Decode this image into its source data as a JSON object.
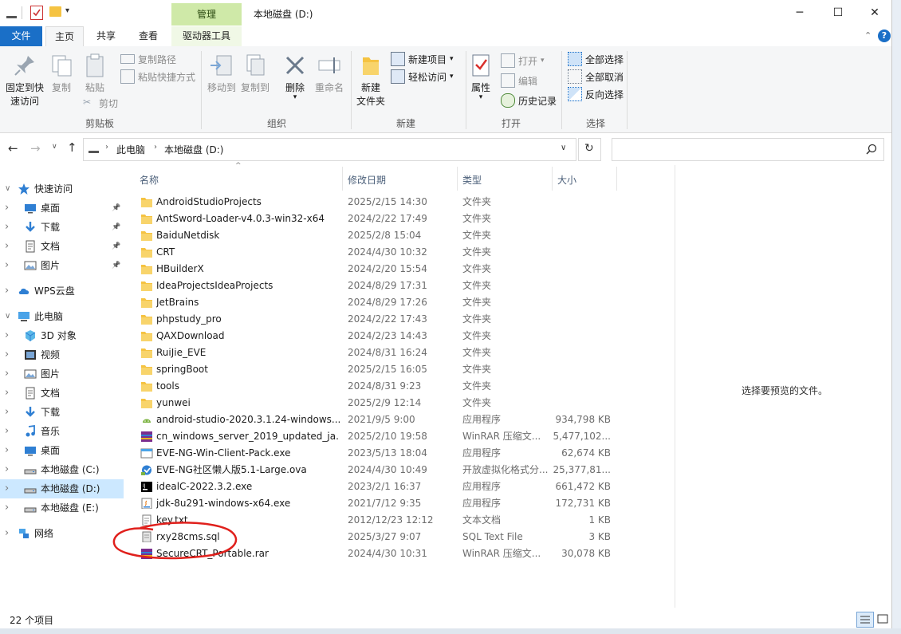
{
  "window": {
    "title": "本地磁盘 (D:)",
    "context_tab": "管理",
    "minimize": "─",
    "maximize": "☐",
    "close": "✕"
  },
  "ribbon_tabs": [
    {
      "label": "文件"
    },
    {
      "label": "主页"
    },
    {
      "label": "共享"
    },
    {
      "label": "查看"
    },
    {
      "label": "驱动器工具"
    }
  ],
  "ribbon": {
    "clipboard": {
      "group_label": "剪贴板",
      "pin_label_1": "固定到快",
      "pin_label_2": "速访问",
      "copy": "复制",
      "paste": "粘贴",
      "copy_path": "复制路径",
      "paste_shortcut": "粘贴快捷方式",
      "cut": "剪切"
    },
    "organize": {
      "group_label": "组织",
      "move_to": "移动到",
      "copy_to": "复制到",
      "delete": "删除",
      "rename": "重命名"
    },
    "new": {
      "group_label": "新建",
      "new_folder_1": "新建",
      "new_folder_2": "文件夹",
      "new_item": "新建项目",
      "easy_access": "轻松访问"
    },
    "open": {
      "group_label": "打开",
      "properties": "属性",
      "open": "打开",
      "edit": "编辑",
      "history": "历史记录"
    },
    "select": {
      "group_label": "选择",
      "select_all": "全部选择",
      "select_none": "全部取消",
      "invert": "反向选择"
    }
  },
  "address": {
    "crumbs": [
      "此电脑",
      "本地磁盘 (D:)"
    ],
    "search_placeholder": ""
  },
  "nav": [
    {
      "label": "快速访问",
      "level": 0,
      "icon": "star-icon",
      "expanded": true
    },
    {
      "label": "桌面",
      "level": 1,
      "icon": "desktop-icon",
      "pinned": true
    },
    {
      "label": "下载",
      "level": 1,
      "icon": "download-icon",
      "pinned": true
    },
    {
      "label": "文档",
      "level": 1,
      "icon": "document-icon",
      "pinned": true
    },
    {
      "label": "图片",
      "level": 1,
      "icon": "picture-icon",
      "pinned": true
    },
    {
      "label": "WPS云盘",
      "level": 0,
      "icon": "cloud-icon"
    },
    {
      "label": "此电脑",
      "level": 0,
      "icon": "computer-icon",
      "expanded": true
    },
    {
      "label": "3D 对象",
      "level": 1,
      "icon": "3d-icon"
    },
    {
      "label": "视频",
      "level": 1,
      "icon": "video-icon"
    },
    {
      "label": "图片",
      "level": 1,
      "icon": "picture-icon"
    },
    {
      "label": "文档",
      "level": 1,
      "icon": "document-icon"
    },
    {
      "label": "下载",
      "level": 1,
      "icon": "download-icon"
    },
    {
      "label": "音乐",
      "level": 1,
      "icon": "music-icon"
    },
    {
      "label": "桌面",
      "level": 1,
      "icon": "desktop-icon"
    },
    {
      "label": "本地磁盘 (C:)",
      "level": 1,
      "icon": "drive-icon"
    },
    {
      "label": "本地磁盘 (D:)",
      "level": 1,
      "icon": "drive-icon",
      "selected": true
    },
    {
      "label": "本地磁盘 (E:)",
      "level": 1,
      "icon": "drive-icon"
    },
    {
      "label": "网络",
      "level": 0,
      "icon": "network-icon"
    }
  ],
  "columns": {
    "name": "名称",
    "date": "修改日期",
    "type": "类型",
    "size": "大小"
  },
  "files": [
    {
      "name": "AndroidStudioProjects",
      "date": "2025/2/15 14:30",
      "type": "文件夹",
      "size": "",
      "icon": "folder"
    },
    {
      "name": "AntSword-Loader-v4.0.3-win32-x64",
      "date": "2024/2/22 17:49",
      "type": "文件夹",
      "size": "",
      "icon": "folder"
    },
    {
      "name": "BaiduNetdisk",
      "date": "2025/2/8 15:04",
      "type": "文件夹",
      "size": "",
      "icon": "folder"
    },
    {
      "name": "CRT",
      "date": "2024/4/30 10:32",
      "type": "文件夹",
      "size": "",
      "icon": "folder"
    },
    {
      "name": "HBuilderX",
      "date": "2024/2/20 15:54",
      "type": "文件夹",
      "size": "",
      "icon": "folder"
    },
    {
      "name": "IdeaProjectsIdeaProjects",
      "date": "2024/8/29 17:31",
      "type": "文件夹",
      "size": "",
      "icon": "folder"
    },
    {
      "name": "JetBrains",
      "date": "2024/8/29 17:26",
      "type": "文件夹",
      "size": "",
      "icon": "folder"
    },
    {
      "name": "phpstudy_pro",
      "date": "2024/2/22 17:43",
      "type": "文件夹",
      "size": "",
      "icon": "folder"
    },
    {
      "name": "QAXDownload",
      "date": "2024/2/23 14:43",
      "type": "文件夹",
      "size": "",
      "icon": "folder"
    },
    {
      "name": "RuiJie_EVE",
      "date": "2024/8/31 16:24",
      "type": "文件夹",
      "size": "",
      "icon": "folder"
    },
    {
      "name": "springBoot",
      "date": "2025/2/15 16:05",
      "type": "文件夹",
      "size": "",
      "icon": "folder"
    },
    {
      "name": "tools",
      "date": "2024/8/31 9:23",
      "type": "文件夹",
      "size": "",
      "icon": "folder"
    },
    {
      "name": "yunwei",
      "date": "2025/2/9 12:14",
      "type": "文件夹",
      "size": "",
      "icon": "folder"
    },
    {
      "name": "android-studio-2020.3.1.24-windows....",
      "date": "2021/9/5 9:00",
      "type": "应用程序",
      "size": "934,798 KB",
      "icon": "android"
    },
    {
      "name": "cn_windows_server_2019_updated_ja...",
      "date": "2025/2/10 19:58",
      "type": "WinRAR 压缩文...",
      "size": "5,477,102...",
      "icon": "rar"
    },
    {
      "name": "EVE-NG-Win-Client-Pack.exe",
      "date": "2023/5/13 18:04",
      "type": "应用程序",
      "size": "62,674 KB",
      "icon": "exe"
    },
    {
      "name": "EVE-NG社区懒人版5.1-Large.ova",
      "date": "2024/4/30 10:49",
      "type": "开放虚拟化格式分...",
      "size": "25,377,81...",
      "icon": "ova"
    },
    {
      "name": "idealC-2022.3.2.exe",
      "date": "2023/2/1 16:37",
      "type": "应用程序",
      "size": "661,472 KB",
      "icon": "idea"
    },
    {
      "name": "jdk-8u291-windows-x64.exe",
      "date": "2021/7/12 9:35",
      "type": "应用程序",
      "size": "172,731 KB",
      "icon": "java"
    },
    {
      "name": "key.txt",
      "date": "2012/12/23 12:12",
      "type": "文本文档",
      "size": "1 KB",
      "icon": "txt"
    },
    {
      "name": "rxy28cms.sql",
      "date": "2025/3/27 9:07",
      "type": "SQL Text File",
      "size": "3 KB",
      "icon": "sql"
    },
    {
      "name": "SecureCRT_Portable.rar",
      "date": "2024/4/30 10:31",
      "type": "WinRAR 压缩文...",
      "size": "30,078 KB",
      "icon": "rar"
    }
  ],
  "preview_text": "选择要预览的文件。",
  "status_text": "22 个项目",
  "colors": {
    "accent": "#1a6fc7",
    "context_tab": "#cfe9a8",
    "selection": "#cce8ff",
    "annotation": "#e0201c",
    "folder": "#f5c342"
  }
}
